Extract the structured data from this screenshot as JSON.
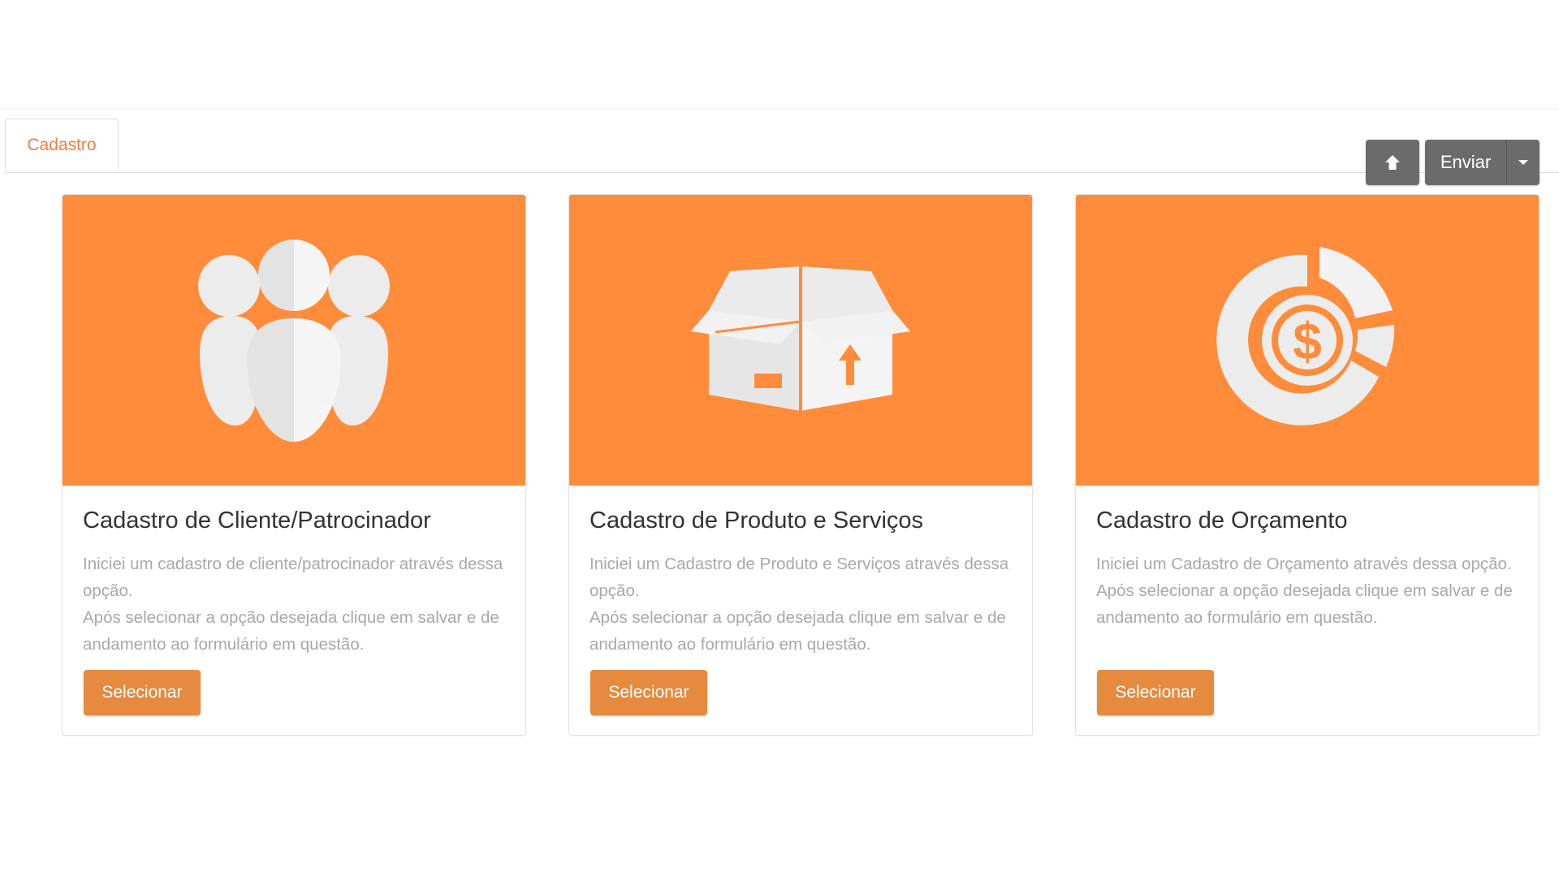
{
  "tab": {
    "label": "Cadastro"
  },
  "toolbar": {
    "up_icon": "arrow-up-icon",
    "send_label": "Enviar",
    "caret_icon": "caret-down-icon"
  },
  "colors": {
    "accent": "#ff8c3a",
    "button": "#e58a3e",
    "tab_text": "#f47a3a",
    "toolbar_button": "#6b6b6b",
    "icon_fill": "#ececec"
  },
  "cards": [
    {
      "icon": "people-group-icon",
      "title": "Cadastro de Cliente/Patrocinador",
      "desc_line1": "Iniciei um cadastro de cliente/patrocinador através dessa opção.",
      "desc_line2": "Após selecionar a opção desejada clique em salvar e de andamento ao formulário em questão.",
      "button": "Selecionar"
    },
    {
      "icon": "open-box-icon",
      "title": "Cadastro de Produto e Serviços",
      "desc_line1": "Iniciei um Cadastro de Produto e Serviços através dessa opção.",
      "desc_line2": "Após selecionar a opção desejada clique em salvar e de andamento ao formulário em questão.",
      "button": "Selecionar"
    },
    {
      "icon": "dollar-chart-icon",
      "title": "Cadastro de Orçamento",
      "desc_line1": "Iniciei um Cadastro de Orçamento através dessa opção.",
      "desc_line2": "Após selecionar a opção desejada clique em salvar e de andamento ao formulário em questão.",
      "button": "Selecionar"
    }
  ]
}
